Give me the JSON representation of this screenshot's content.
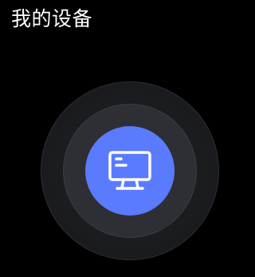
{
  "header": {
    "title": "我的设备"
  },
  "device_scan": {
    "center_icon": "monitor-icon",
    "accent_color": "#5b7bff",
    "ring_colors": [
      "#1a1b1e",
      "#2e2f34"
    ]
  }
}
